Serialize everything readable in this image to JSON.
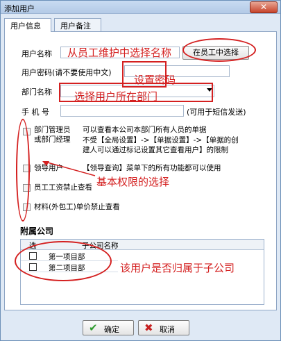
{
  "window": {
    "title": "添加用户",
    "close_glyph": "✕"
  },
  "tabs": [
    {
      "label": "用户信息",
      "active": true
    },
    {
      "label": "用户备注",
      "active": false
    }
  ],
  "form": {
    "username_label": "用户名称",
    "username_value": "",
    "pick_button": "在员工中选择",
    "password_label": "用户密码(请不要使用中文)",
    "department_label": "部门名称",
    "phone_label": "手  机  号",
    "phone_hint": "(可用于短信发送)"
  },
  "permissions": [
    {
      "label_line1": "部门管理员",
      "label_line2": "或部门经理",
      "desc_line1": "可以查看本公司本部门所有人员的单据",
      "desc_line2": "不受【全局设置】->【单据设置】->【单据的创",
      "desc_line3": "建人可以通过标记设置其它查看用户】的限制"
    },
    {
      "label_line1": "领导用户",
      "desc_line1": "【领导查询】菜单下的所有功能都可以使用"
    },
    {
      "label_line1": "员工工资禁止查看"
    },
    {
      "label_line1": "材料(外包工)单价禁止查看"
    }
  ],
  "companies": {
    "title": "附属公司",
    "col_select": "选",
    "col_name": "子公司名称",
    "rows": [
      {
        "name": "第一项目部"
      },
      {
        "name": "第二项目部"
      }
    ]
  },
  "footer": {
    "ok_label": "确定",
    "cancel_label": "取消"
  },
  "annotations": {
    "from_employee": "从员工维护中选择名称",
    "set_password": "设置密码",
    "select_department": "选择用户所在部门",
    "basic_permissions": "基本权限的选择",
    "subsidiary": "该用户是否归属于子公司"
  },
  "colors": {
    "annotation": "#d42020",
    "ok_icon": "#2e9b2e",
    "cancel_icon": "#c62020"
  }
}
